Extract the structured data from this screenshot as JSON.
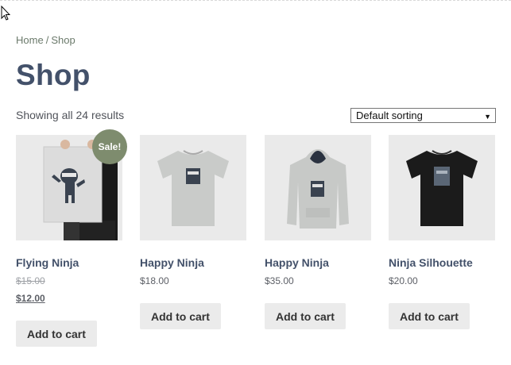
{
  "breadcrumb": {
    "home": "Home",
    "separator": "/",
    "current": "Shop"
  },
  "page": {
    "title": "Shop",
    "result_count": "Showing all 24 results"
  },
  "sorting": {
    "selected": "Default sorting"
  },
  "products": [
    {
      "name": "Flying Ninja",
      "old_price": "$15.00",
      "price": "$12.00",
      "badge": "Sale!",
      "button": "Add to cart"
    },
    {
      "name": "Happy Ninja",
      "price": "$18.00",
      "button": "Add to cart"
    },
    {
      "name": "Happy Ninja",
      "price": "$35.00",
      "button": "Add to cart"
    },
    {
      "name": "Ninja Silhouette",
      "price": "$20.00",
      "button": "Add to cart"
    }
  ],
  "colors": {
    "title": "#43516a",
    "badge": "#7e8c6e",
    "button_bg": "#ebebeb",
    "image_bg": "#eaeaea"
  }
}
